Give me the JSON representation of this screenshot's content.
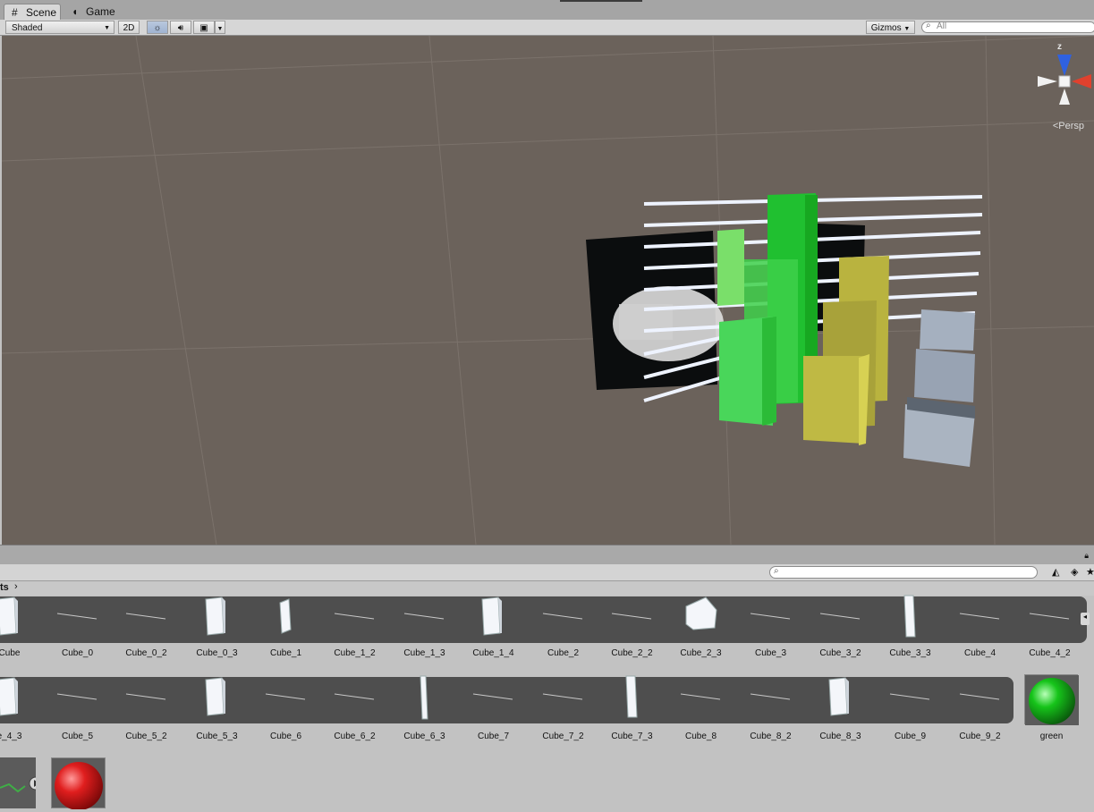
{
  "tabs": [
    {
      "label": "Scene",
      "icon": "grid-icon"
    },
    {
      "label": "Game",
      "icon": "pacman-icon"
    }
  ],
  "scene_toolbar": {
    "shading_mode": "Shaded",
    "mode_2d": "2D",
    "gizmos_label": "Gizmos",
    "search_placeholder": "All"
  },
  "scene_gizmo": {
    "axis_label": "z",
    "projection_label": "Persp"
  },
  "project": {
    "breadcrumb": "ts",
    "search_placeholder": ""
  },
  "assets_row1": [
    "Cube",
    "Cube_0",
    "Cube_0_2",
    "Cube_0_3",
    "Cube_1",
    "Cube_1_2",
    "Cube_1_3",
    "Cube_1_4",
    "Cube_2",
    "Cube_2_2",
    "Cube_2_3",
    "Cube_3",
    "Cube_3_2",
    "Cube_3_3",
    "Cube_4",
    "Cube_4_2"
  ],
  "assets_row2": [
    "e_4_3",
    "Cube_5",
    "Cube_5_2",
    "Cube_5_3",
    "Cube_6",
    "Cube_6_2",
    "Cube_6_3",
    "Cube_7",
    "Cube_7_2",
    "Cube_7_3",
    "Cube_8",
    "Cube_8_2",
    "Cube_8_3",
    "Cube_9",
    "Cube_9_2",
    "green"
  ],
  "colors": {
    "viewport_bg": "#6b625b",
    "green_material": "#16c41a",
    "red_material": "#d01818",
    "yellow_bars": "#c8c24a",
    "gray_bars": "#a7b1bf"
  }
}
